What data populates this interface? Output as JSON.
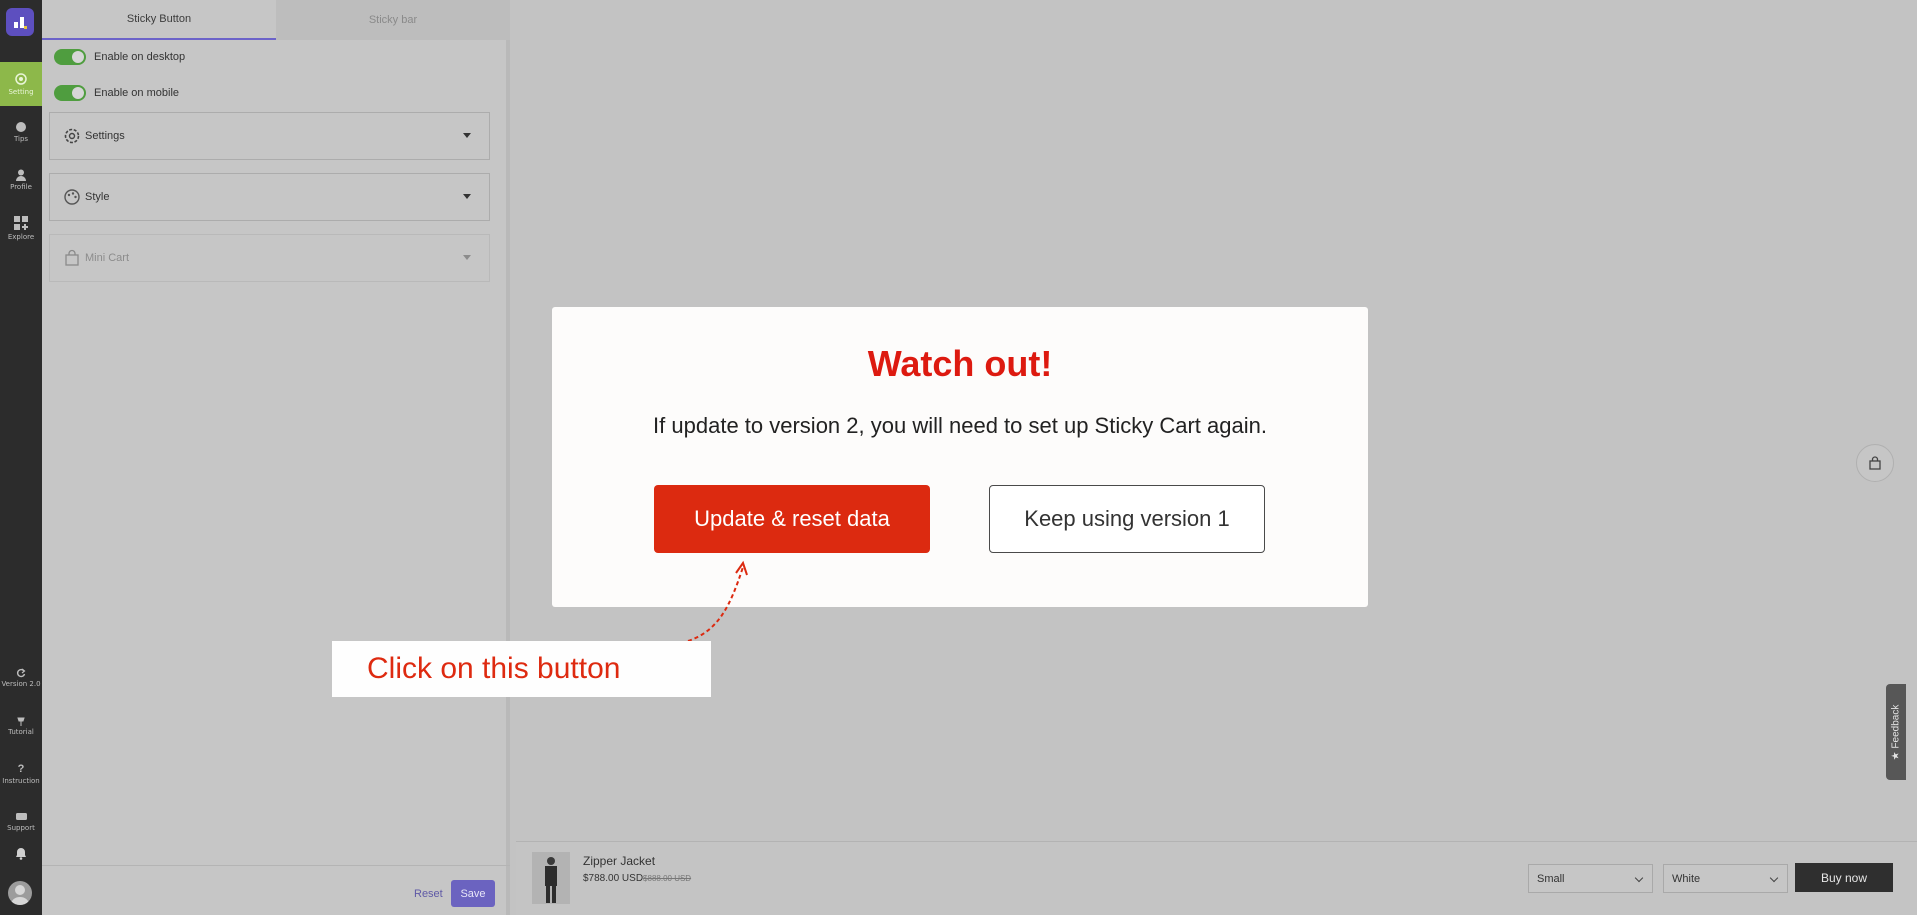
{
  "rail": {
    "items": [
      {
        "label": "Setting",
        "icon": "gear-icon"
      },
      {
        "label": "Tips",
        "icon": "bulb-icon"
      },
      {
        "label": "Profile",
        "icon": "user-icon"
      },
      {
        "label": "Explore",
        "icon": "apps-icon"
      },
      {
        "label": "Version 2.0",
        "icon": "refresh-icon"
      },
      {
        "label": "Tutorial",
        "icon": "pin-icon"
      },
      {
        "label": "Instruction",
        "icon": "question-icon"
      },
      {
        "label": "Support",
        "icon": "chat-icon"
      }
    ]
  },
  "panel": {
    "tabs": [
      "Sticky Button",
      "Sticky bar"
    ],
    "toggles": [
      "Enable on desktop",
      "Enable on mobile"
    ],
    "sections": [
      "Settings",
      "Style",
      "Mini Cart"
    ],
    "reset_label": "Reset",
    "save_label": "Save"
  },
  "sticky_bar": {
    "product_name": "Zipper Jacket",
    "price": "$788.00 USD",
    "old_price": "$888.00 USD",
    "size": "Small",
    "color": "White",
    "buy_label": "Buy now"
  },
  "feedback_label": "Feedback",
  "modal": {
    "title": "Watch out!",
    "message": "If update to version 2, you will need to set up Sticky Cart again.",
    "primary_label": "Update & reset data",
    "secondary_label": "Keep using version 1"
  },
  "callout": {
    "text": "Click on this button"
  },
  "colors": {
    "accent": "#dc2a10",
    "title_red": "#dd1a10",
    "purple": "#6b63c0",
    "green": "#4f9d3f"
  }
}
